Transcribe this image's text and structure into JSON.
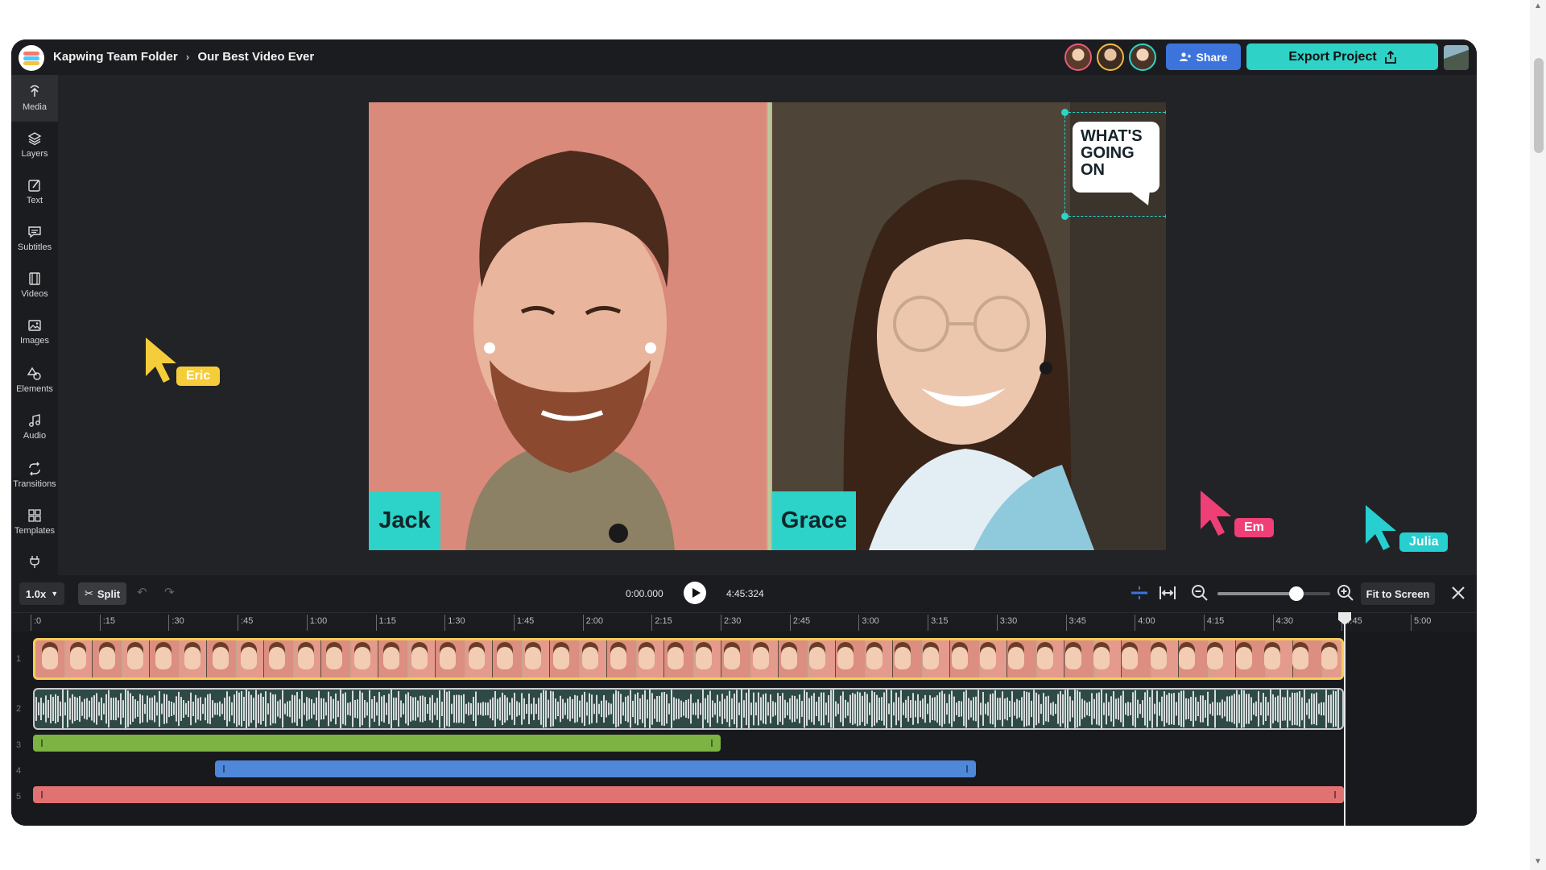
{
  "header": {
    "folder": "Kapwing Team Folder",
    "separator": "›",
    "project": "Our Best Video Ever",
    "share_label": "Share",
    "export_label": "Export Project"
  },
  "sidebar": {
    "items": [
      {
        "label": "Media",
        "icon": "upload-icon"
      },
      {
        "label": "Layers",
        "icon": "layers-icon"
      },
      {
        "label": "Text",
        "icon": "text-icon"
      },
      {
        "label": "Subtitles",
        "icon": "subtitles-icon"
      },
      {
        "label": "Videos",
        "icon": "film-icon"
      },
      {
        "label": "Images",
        "icon": "image-icon"
      },
      {
        "label": "Elements",
        "icon": "shapes-icon"
      },
      {
        "label": "Audio",
        "icon": "music-icon"
      },
      {
        "label": "Transitions",
        "icon": "transitions-icon"
      },
      {
        "label": "Templates",
        "icon": "grid-icon"
      }
    ]
  },
  "canvas": {
    "left_name": "Jack",
    "right_name": "Grace",
    "speech_bubble": "WHAT'S GOING ON"
  },
  "collaborators": {
    "eric": "Eric",
    "em": "Em",
    "julia": "Julia"
  },
  "colors": {
    "accent_teal": "#2dd3c8",
    "share_blue": "#3d74db",
    "cursor_yellow": "#f5cd3b",
    "cursor_pink": "#ef3f77",
    "cursor_cyan": "#27cfd0",
    "track_green": "#7cb342",
    "track_blue": "#4f87d9",
    "track_red": "#e07272"
  },
  "controls": {
    "speed": "1.0x",
    "split_label": "Split",
    "current_time": "0:00.000",
    "total_time": "4:45:324",
    "fit_label": "Fit to Screen",
    "zoom_level": 0.7
  },
  "ruler": {
    "ticks": [
      ":0",
      ":15",
      ":30",
      ":45",
      "1:00",
      "1:15",
      "1:30",
      "1:45",
      "2:00",
      "2:15",
      "2:30",
      "2:45",
      "3:00",
      "3:15",
      "3:30",
      "3:45",
      "4:00",
      "4:15",
      "4:30",
      "4:45",
      "5:00"
    ]
  },
  "tracks": {
    "numbers": [
      "1",
      "2",
      "3",
      "4",
      "5"
    ]
  }
}
